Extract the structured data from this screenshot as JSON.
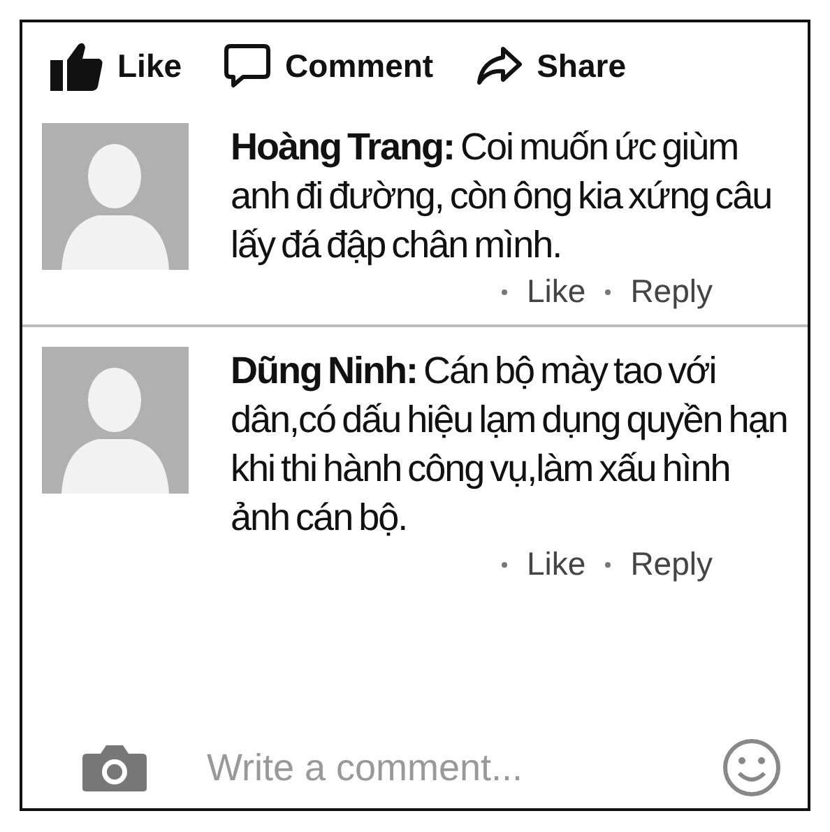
{
  "actions": [
    {
      "kind": "like",
      "label": "Like"
    },
    {
      "kind": "comment",
      "label": "Comment"
    },
    {
      "kind": "share",
      "label": "Share"
    }
  ],
  "comments": [
    {
      "text": "**Hoàng Trang:** Coi muốn ức giùm anh đi đường, còn ông kia xứng câu lấy đá đập chân mình.",
      "links": [
        "Like",
        "Reply"
      ]
    },
    {
      "text": "**Dũng Ninh:** Cán bộ mày tao với dân,có dấu hiệu lạm dụng quyền hạn khi thi hành công vụ,làm xấu hình ảnh cán bộ.",
      "links": [
        "Like",
        "Reply"
      ]
    }
  ],
  "composer": {
    "placeholder": "Write a comment..."
  }
}
